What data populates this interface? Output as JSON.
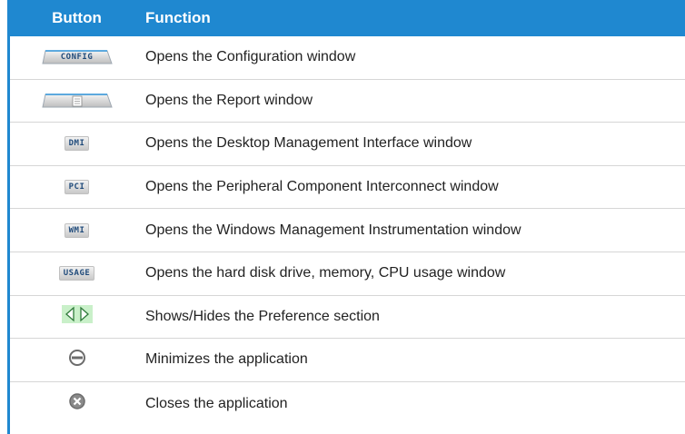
{
  "header": {
    "button": "Button",
    "function": "Function"
  },
  "rows": [
    {
      "icon": "config-tab-icon",
      "label": "CONFIG",
      "function": "Opens the Configuration window"
    },
    {
      "icon": "report-tab-icon",
      "label": "",
      "function": "Opens the Report window"
    },
    {
      "icon": "dmi-button-icon",
      "label": "DMI",
      "function": "Opens the Desktop Management Interface window"
    },
    {
      "icon": "pci-button-icon",
      "label": "PCI",
      "function": "Opens the Peripheral Component Interconnect window"
    },
    {
      "icon": "wmi-button-icon",
      "label": "WMI",
      "function": "Opens the Windows Management Instrumentation window"
    },
    {
      "icon": "usage-button-icon",
      "label": "USAGE",
      "function": "Opens the hard disk drive, memory, CPU usage window"
    },
    {
      "icon": "show-hide-arrows-icon",
      "label": "",
      "function": "Shows/Hides the Preference section"
    },
    {
      "icon": "minimize-icon",
      "label": "",
      "function": "Minimizes the application"
    },
    {
      "icon": "close-icon",
      "label": "",
      "function": "Closes the application"
    }
  ],
  "colors": {
    "header": "#1f88d0",
    "accent_green": "#2fa84f",
    "gray_icon": "#777777"
  }
}
